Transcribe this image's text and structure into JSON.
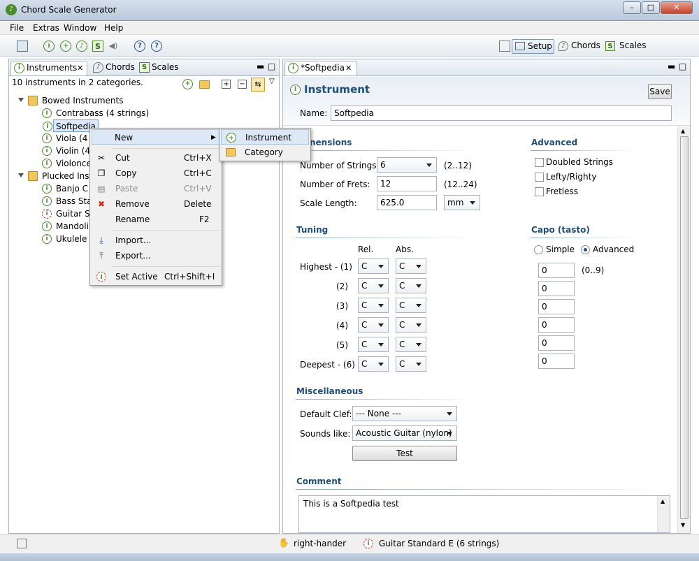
{
  "window": {
    "title": "Chord Scale Generator"
  },
  "menu": [
    "File",
    "Extras",
    "Window",
    "Help"
  ],
  "perspectives": {
    "setup": "Setup",
    "chords": "Chords",
    "scales": "Scales"
  },
  "left_panel": {
    "tabs": {
      "instruments": "Instruments",
      "chords": "Chords",
      "scales": "Scales"
    },
    "summary": "10 instruments in 2 categories.",
    "tree": {
      "bowed": "Bowed Instruments",
      "contrabass": "Contrabass (4 strings)",
      "softpedia": "Softpedia",
      "viola": "Viola (4 st",
      "violin": "Violin (4 s",
      "violoncello": "Violoncel",
      "plucked": "Plucked Instr",
      "banjo": "Banjo C (",
      "bass": "Bass Stan",
      "guitar": "Guitar Sta",
      "mandolin": "Mandolin",
      "ukulele": "Ukulele S"
    }
  },
  "context_menu": {
    "new": "New",
    "cut": "Cut",
    "cut_sc": "Ctrl+X",
    "copy": "Copy",
    "copy_sc": "Ctrl+C",
    "paste": "Paste",
    "paste_sc": "Ctrl+V",
    "remove": "Remove",
    "remove_sc": "Delete",
    "rename": "Rename",
    "rename_sc": "F2",
    "import": "Import...",
    "export": "Export...",
    "set_active": "Set Active",
    "set_active_sc": "Ctrl+Shift+I"
  },
  "submenu": {
    "instrument": "Instrument",
    "category": "Category"
  },
  "editor": {
    "tab_title": "*Softpedia",
    "heading": "Instrument",
    "save_label": "Save",
    "name_label": "Name:",
    "name_value": "Softpedia",
    "dimensions": {
      "title": "nensions",
      "strings_label": "Number of Strings:",
      "strings_value": "6",
      "strings_range": "(2..12)",
      "frets_label": "Number of Frets:",
      "frets_value": "12",
      "frets_range": "(12..24)",
      "scale_label": "Scale Length:",
      "scale_value": "625.0",
      "scale_unit": "mm"
    },
    "advanced": {
      "title": "Advanced",
      "doubled": "Doubled Strings",
      "lefty": "Lefty/Righty",
      "fretless": "Fretless"
    },
    "tuning": {
      "title": "Tuning",
      "rel": "Rel.",
      "abs": "Abs.",
      "rows": [
        {
          "label": "Highest - (1)",
          "rel": "C",
          "abs": "C"
        },
        {
          "label": "(2)",
          "rel": "C",
          "abs": "C"
        },
        {
          "label": "(3)",
          "rel": "C",
          "abs": "C"
        },
        {
          "label": "(4)",
          "rel": "C",
          "abs": "C"
        },
        {
          "label": "(5)",
          "rel": "C",
          "abs": "C"
        },
        {
          "label": "Deepest - (6)",
          "rel": "C",
          "abs": "C"
        }
      ]
    },
    "capo": {
      "title": "Capo (tasto)",
      "simple": "Simple",
      "advanced": "Advanced",
      "values": [
        "0",
        "0",
        "0",
        "0",
        "0",
        "0"
      ],
      "range": "(0..9)"
    },
    "misc": {
      "title": "Miscellaneous",
      "clef_label": "Default Clef:",
      "clef_value": "--- None ---",
      "sounds_label": "Sounds like:",
      "sounds_value": "Acoustic Guitar (nylon)",
      "test_label": "Test"
    },
    "comment": {
      "title": "Comment",
      "value": "This is a Softpedia test"
    }
  },
  "status": {
    "hand": "right-hander",
    "active_instrument": "Guitar Standard E (6 strings)"
  },
  "colors": {
    "section_title": "#1f4f7a",
    "accent_green": "#4a8a2a",
    "selection": "#dbe9f8"
  }
}
